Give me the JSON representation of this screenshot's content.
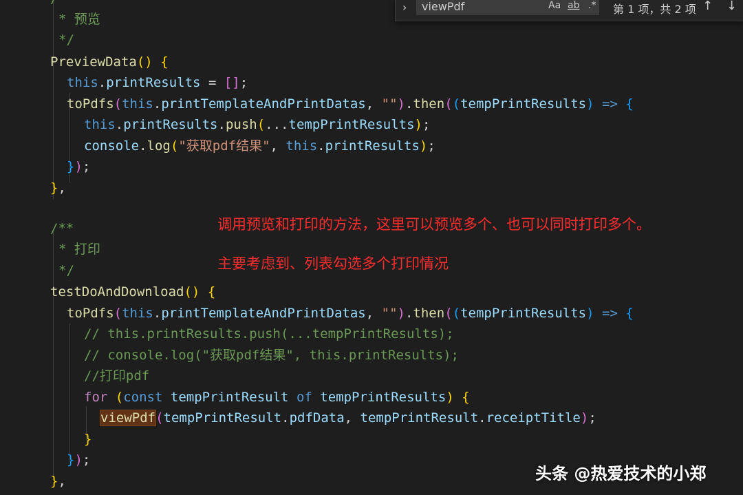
{
  "find_widget": {
    "query": "viewPdf",
    "match_case": "Aa",
    "whole_word": "ab",
    "regex": ".*",
    "result": "第 1 项，共 2 项",
    "prev_icon": "arrow-up-icon",
    "next_icon": "arrow-down-icon",
    "toggle_icon": "chevron-right-icon"
  },
  "code": {
    "l0": "/**",
    "l1": "* 预览",
    "l2": "*/",
    "l3_fn": "PreviewData",
    "l4_var": "printResults",
    "l5_fn": "toPdfs",
    "l5_arg": "printTemplateAndPrintDatas",
    "l5_then": "then",
    "l5_param": "tempPrintResults",
    "l6_var": "printResults",
    "l6_fn": "push",
    "l6_arg": "tempPrintResults",
    "l7_obj": "console",
    "l7_fn": "log",
    "l7_str": "\"获取pdf结果\"",
    "l7_var": "printResults",
    "l11": "/**",
    "l12": "* 打印",
    "l13": "*/",
    "l14_fn": "testDoAndDownload",
    "l15_fn": "toPdfs",
    "l15_arg": "printTemplateAndPrintDatas",
    "l15_then": "then",
    "l15_param": "tempPrintResults",
    "l16": "// this.printResults.push(...tempPrintResults);",
    "l17": "// console.log(\"获取pdf结果\", this.printResults);",
    "l18": "//打印pdf",
    "l19_for": "for",
    "l19_const": "const",
    "l19_item": "tempPrintResult",
    "l19_of": "of",
    "l19_list": "tempPrintResults",
    "l20_fn": "viewPdf",
    "l20_a1": "tempPrintResult",
    "l20_p1": "pdfData",
    "l20_a2": "tempPrintResult",
    "l20_p2": "receiptTitle",
    "this_kw": "this",
    "empty_str": "\"\""
  },
  "annotations": {
    "note1": "调用预览和打印的方法，这里可以预览多个、也可以同时打印多个。",
    "note2": "主要考虑到、列表勾选多个打印情况"
  },
  "watermark": "头条 @热爱技术的小郑",
  "colors": {
    "background": "#1e1e1e",
    "annotation": "#ff2d2d",
    "function": "#dcdcaa",
    "keyword": "#569cd6",
    "variable": "#9cdcfe",
    "comment": "#6a9955"
  }
}
